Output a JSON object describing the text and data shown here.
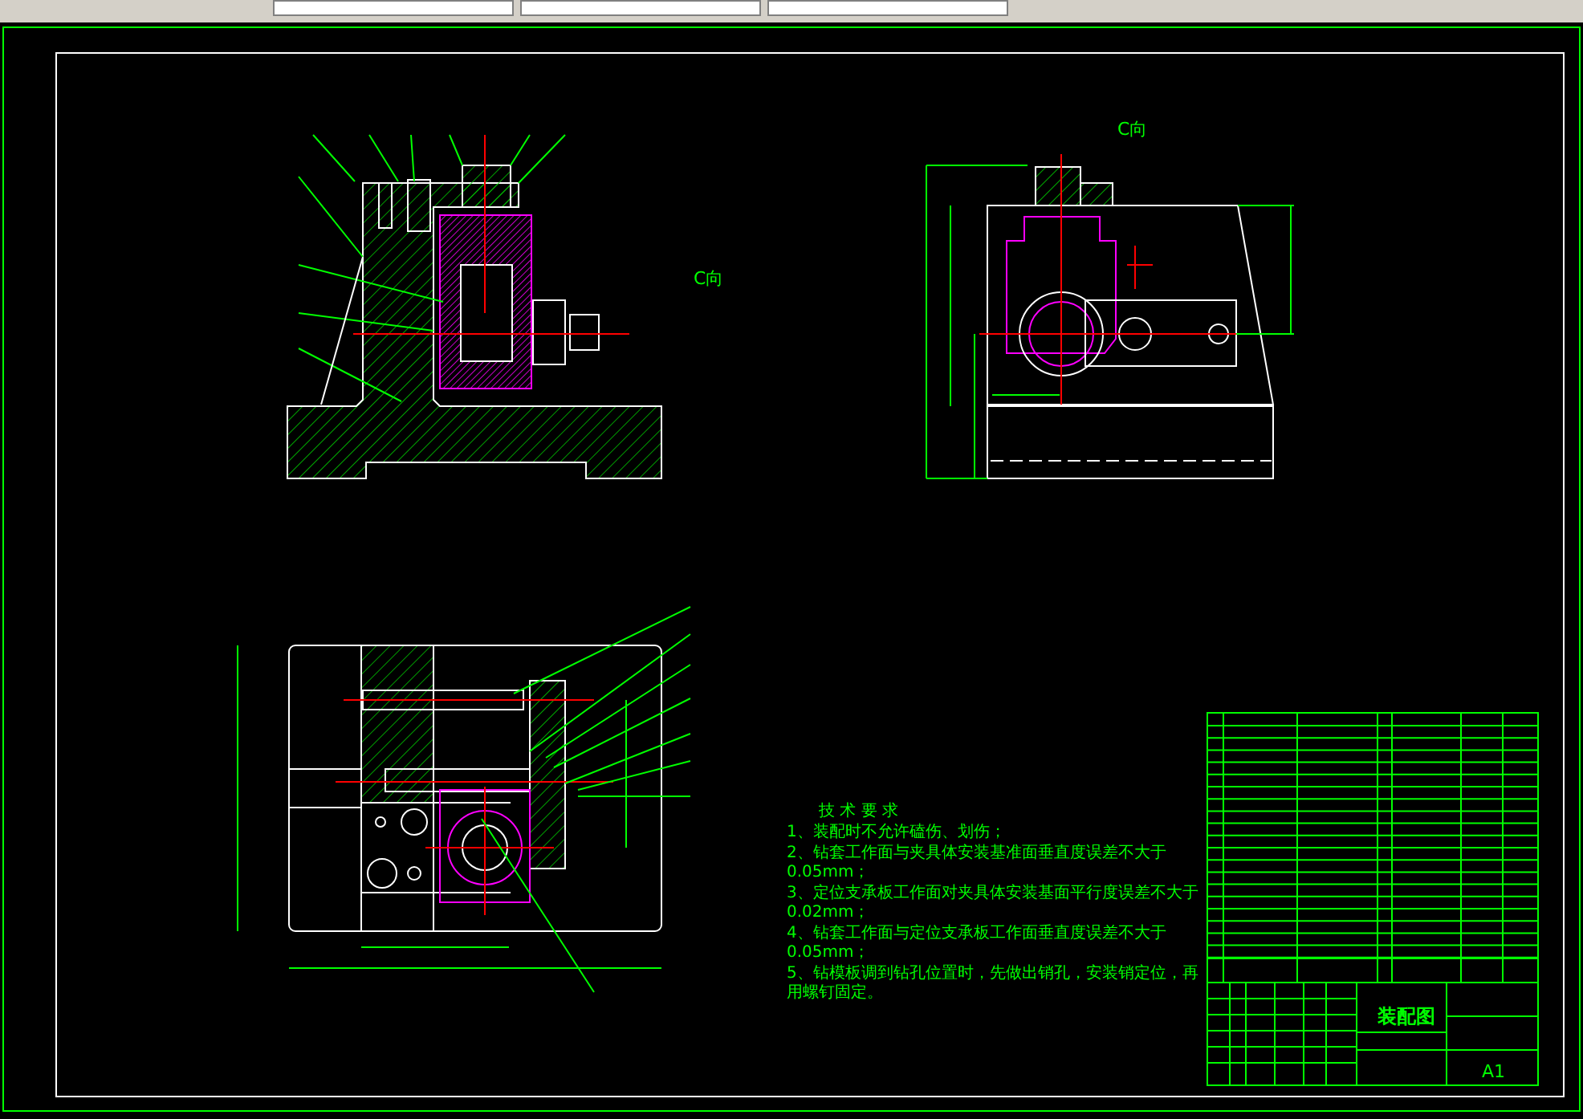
{
  "drawing": {
    "view_labels": [
      "C向",
      "C向"
    ],
    "technical_requirements": {
      "title": "技 术 要 求",
      "items": [
        "1、装配时不允许磕伤、划伤；",
        "2、钻套工作面与夹具体安装基准面垂直度误差不大于0.05mm；",
        "3、定位支承板工作面对夹具体安装基面平行度误差不大于0.02mm；",
        "4、钻套工作面与定位支承板工作面垂直度误差不大于0.05mm；",
        "5、钻模板调到钻孔位置时，先做出销孔，安装销定位，再用螺钉固定。"
      ]
    },
    "title_block": {
      "drawing_name": "装配图",
      "sheet_size": "A1"
    }
  }
}
